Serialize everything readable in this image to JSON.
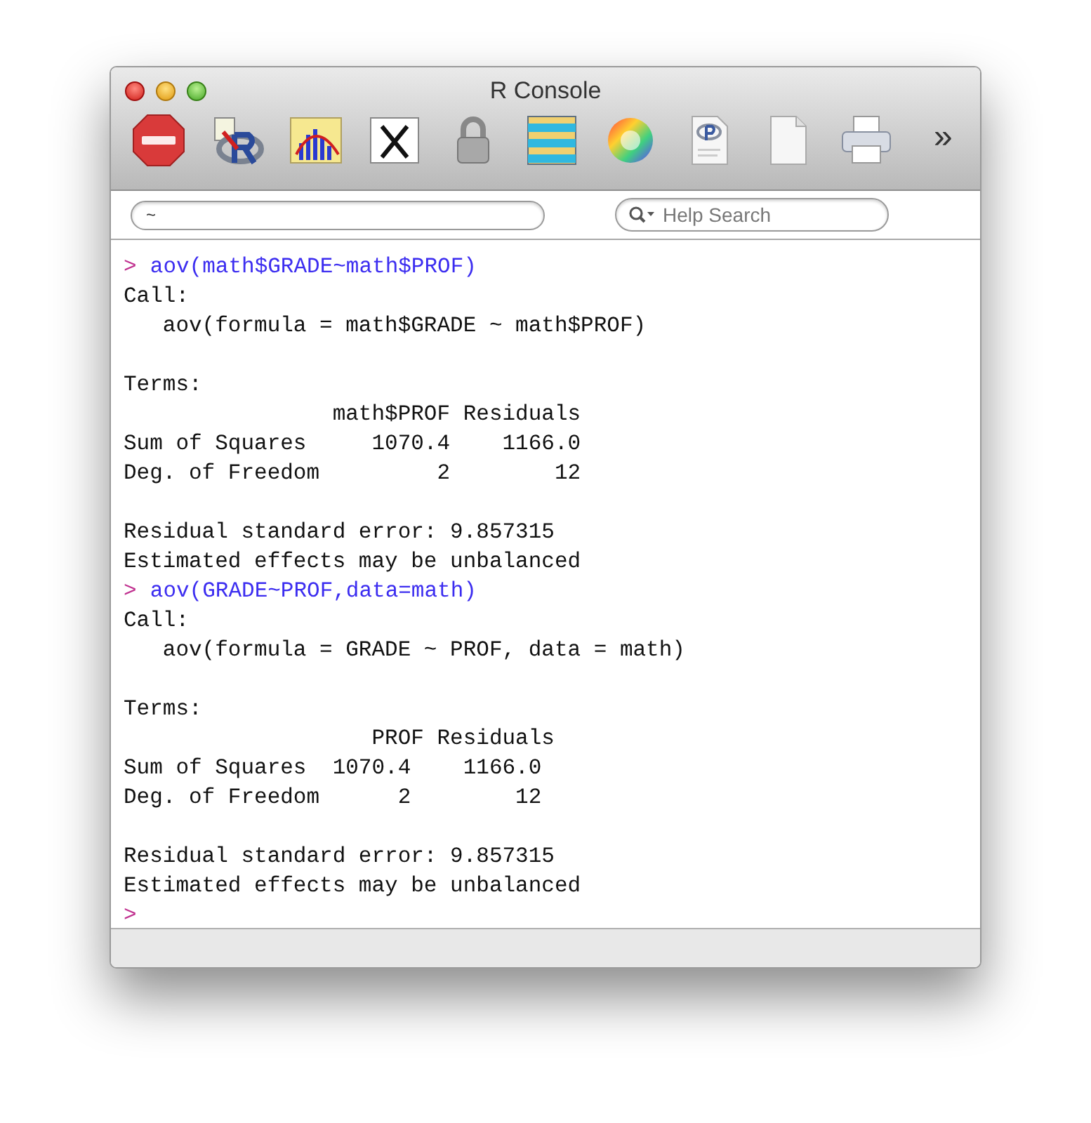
{
  "window": {
    "title": "R Console"
  },
  "toolbar": {
    "overflow": "»"
  },
  "path_field": {
    "value": "~"
  },
  "help_search": {
    "placeholder": "Help Search"
  },
  "console": {
    "lines": [
      {
        "kind": "command",
        "prompt": ">",
        "text": "aov(math$GRADE~math$PROF)"
      },
      {
        "kind": "output",
        "text": "Call:"
      },
      {
        "kind": "output",
        "text": "   aov(formula = math$GRADE ~ math$PROF)"
      },
      {
        "kind": "blank"
      },
      {
        "kind": "output",
        "text": "Terms:"
      },
      {
        "kind": "output",
        "text": "                math$PROF Residuals"
      },
      {
        "kind": "output",
        "text": "Sum of Squares     1070.4    1166.0"
      },
      {
        "kind": "output",
        "text": "Deg. of Freedom         2        12"
      },
      {
        "kind": "blank"
      },
      {
        "kind": "output",
        "text": "Residual standard error: 9.857315"
      },
      {
        "kind": "output",
        "text": "Estimated effects may be unbalanced"
      },
      {
        "kind": "command",
        "prompt": ">",
        "text": "aov(GRADE~PROF,data=math)"
      },
      {
        "kind": "output",
        "text": "Call:"
      },
      {
        "kind": "output",
        "text": "   aov(formula = GRADE ~ PROF, data = math)"
      },
      {
        "kind": "blank"
      },
      {
        "kind": "output",
        "text": "Terms:"
      },
      {
        "kind": "output",
        "text": "                   PROF Residuals"
      },
      {
        "kind": "output",
        "text": "Sum of Squares  1070.4    1166.0"
      },
      {
        "kind": "output",
        "text": "Deg. of Freedom      2        12"
      },
      {
        "kind": "blank"
      },
      {
        "kind": "output",
        "text": "Residual standard error: 9.857315"
      },
      {
        "kind": "output",
        "text": "Estimated effects may be unbalanced"
      },
      {
        "kind": "command",
        "prompt": ">"
      }
    ]
  }
}
